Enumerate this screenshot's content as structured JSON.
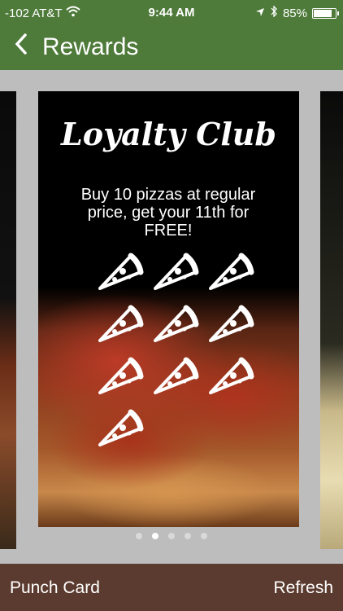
{
  "status_bar": {
    "carrier": "-102 AT&T",
    "time": "9:44 AM",
    "battery": "85%",
    "battery_level": 0.85,
    "icons": [
      "wifi-icon",
      "location-arrow-icon",
      "bluetooth-icon",
      "battery-icon"
    ]
  },
  "nav": {
    "back_icon": "chevron-left-icon",
    "title": "Rewards"
  },
  "card": {
    "title": "Loyalty Club",
    "description": "Buy 10 pizzas at regular price, get your 11th for FREE!",
    "punch_icon": "pizza-slice-icon",
    "punch_count": 10
  },
  "pager": {
    "count": 5,
    "active_index": 1
  },
  "toolbar": {
    "punch_card": "Punch Card",
    "refresh": "Refresh"
  },
  "colors": {
    "navbar": "#4e7a3a",
    "toolbar": "#5b3b2f",
    "carousel_bg": "#bdbdbd"
  }
}
